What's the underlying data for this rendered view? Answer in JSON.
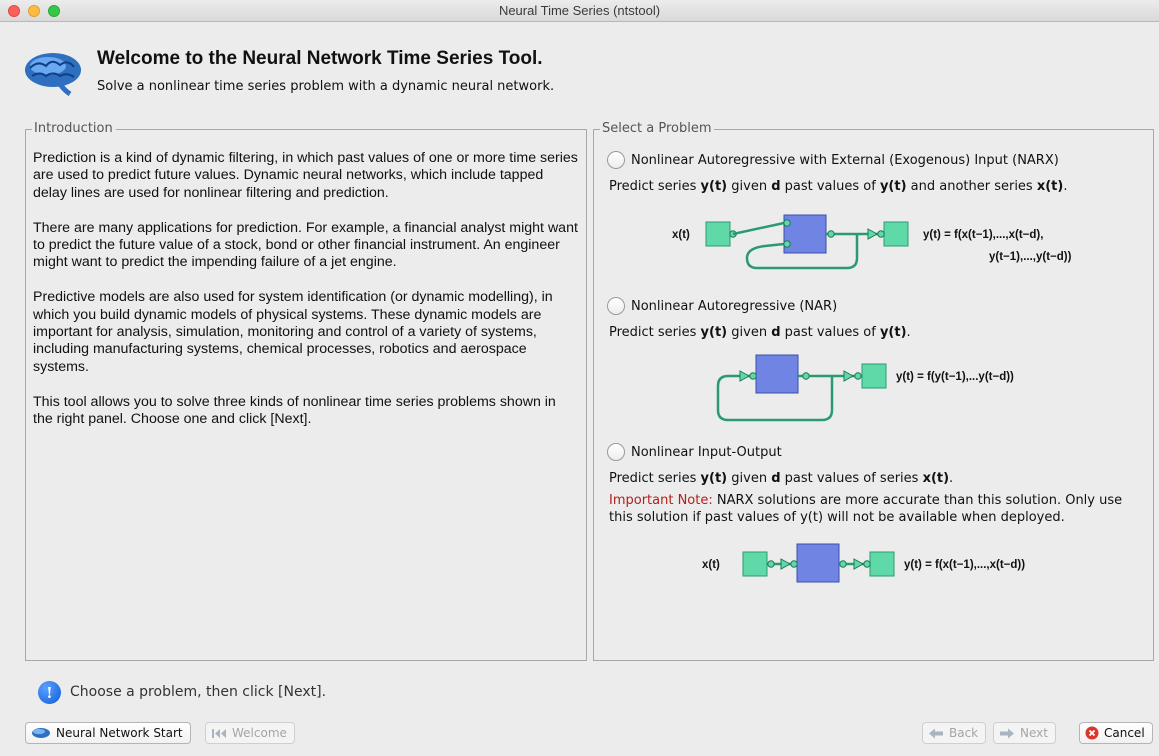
{
  "window": {
    "title": "Neural Time Series (ntstool)"
  },
  "header": {
    "title": "Welcome to the Neural Network Time Series Tool.",
    "subtitle": "Solve a nonlinear time series problem with a dynamic neural network."
  },
  "introduction": {
    "title": "Introduction",
    "paragraphs": [
      "Prediction is a kind of dynamic filtering, in which past values of one or more time series are used to predict future values. Dynamic neural networks, which include tapped delay lines are used for nonlinear filtering and prediction.",
      "There are many applications for prediction. For example, a financial analyst might want to predict the future value of a stock, bond or other financial instrument. An engineer might want to predict the impending failure of a jet engine.",
      "Predictive models are also used for system identification (or dynamic modelling), in which you build dynamic models of physical systems. These dynamic models are important for analysis, simulation, monitoring and control of a variety of systems, including manufacturing systems, chemical processes, robotics and aerospace systems.",
      "This tool allows you to solve three kinds of nonlinear time series problems shown in the right panel. Choose one and click [Next]."
    ]
  },
  "problems": {
    "title": "Select a Problem",
    "narx": {
      "label": "Nonlinear Autoregressive with External (Exogenous) Input (NARX)",
      "desc": {
        "t1": "Predict series ",
        "y": "y(t)",
        "t2": " given ",
        "d": "d",
        "t3": " past values of ",
        "y2": "y(t)",
        "t4": " and another series ",
        "x": "x(t)",
        "t5": "."
      },
      "diagram": {
        "input": "x(t)",
        "eq1": "y(t) = f(x(t−1),...,x(t−d),",
        "eq2": "y(t−1),...,y(t−d))"
      }
    },
    "nar": {
      "label": "Nonlinear Autoregressive (NAR)",
      "desc": {
        "t1": "Predict series ",
        "y": "y(t)",
        "t2": " given ",
        "d": "d",
        "t3": " past values of ",
        "y2": "y(t)",
        "t4": "."
      },
      "diagram": {
        "eq": "y(t) = f(y(t−1),...y(t−d))"
      }
    },
    "io": {
      "label": "Nonlinear Input-Output",
      "desc": {
        "t1": "Predict series ",
        "y": "y(t)",
        "t2": " given ",
        "d": "d",
        "t3": " past values of series ",
        "x": "x(t)",
        "t4": "."
      },
      "note_label": "Important Note:",
      "note_text": " NARX solutions are more accurate than this solution. Only use this solution if past values of y(t) will not be available when deployed.",
      "diagram": {
        "input": "x(t)",
        "eq": "y(t) = f(x(t−1),...,x(t−d))"
      }
    }
  },
  "status": {
    "message": "Choose a problem, then click [Next]."
  },
  "buttons": {
    "start": "Neural Network Start",
    "welcome": "Welcome",
    "back": "Back",
    "next": "Next",
    "cancel": "Cancel"
  },
  "colors": {
    "block": "#6f84e3",
    "tap": "#5fd9a8",
    "note": "#b3201c"
  },
  "icons": [
    "brain-icon",
    "info-icon",
    "brain-small-icon",
    "first-page-icon",
    "back-arrow-icon",
    "next-arrow-icon",
    "cancel-icon"
  ]
}
